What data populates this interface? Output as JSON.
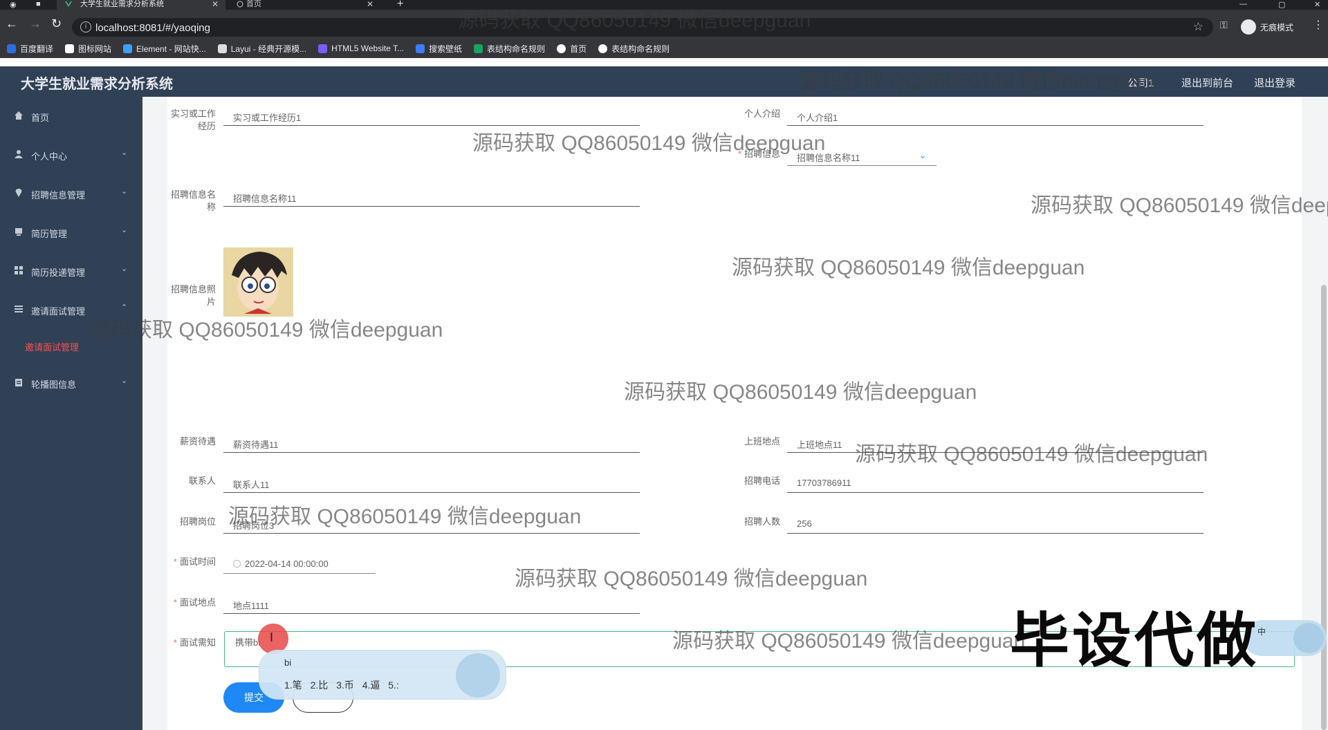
{
  "browser": {
    "tabs": [
      {
        "title": "大学生就业需求分析系统",
        "active": true
      },
      {
        "title": "首页",
        "active": false
      }
    ],
    "url": "localhost:8081/#/yaoqing",
    "incognito_label": "无痕模式",
    "bookmarks": [
      {
        "label": "百度翻译",
        "icon": "baidu-icon",
        "color": "#2b6de4"
      },
      {
        "label": "图标网站",
        "icon": "flag-icon",
        "color": "#ffffff"
      },
      {
        "label": "Element - 网站快...",
        "icon": "element-icon",
        "color": "#409eff"
      },
      {
        "label": "Layui - 经典开源模...",
        "icon": "layui-icon",
        "color": "#dddddd"
      },
      {
        "label": "HTML5 Website T...",
        "icon": "html5-icon",
        "color": "#7a5cff"
      },
      {
        "label": "搜索壁纸",
        "icon": "wallpaper-icon",
        "color": "#3f7df5"
      },
      {
        "label": "表结构命名规则",
        "icon": "sheet-icon",
        "color": "#1aa260"
      },
      {
        "label": "首页",
        "icon": "globe-icon",
        "color": "#ffffff"
      },
      {
        "label": "表结构命名规则",
        "icon": "globe-icon",
        "color": "#ffffff"
      }
    ]
  },
  "header": {
    "title": "大学生就业需求分析系统",
    "user": "公司1",
    "to_front": "退出到前台",
    "logout": "退出登录"
  },
  "sidebar": {
    "items": [
      {
        "label": "首页",
        "icon": "home-icon",
        "expandable": false
      },
      {
        "label": "个人中心",
        "icon": "user-icon",
        "expandable": true
      },
      {
        "label": "招聘信息管理",
        "icon": "pin-icon",
        "expandable": true
      },
      {
        "label": "简历管理",
        "icon": "resume-icon",
        "expandable": true
      },
      {
        "label": "简历投递管理",
        "icon": "grid-icon",
        "expandable": true
      },
      {
        "label": "邀请面试管理",
        "icon": "list-icon",
        "expandable": true,
        "expanded": true
      },
      {
        "label": "轮播图信息",
        "icon": "clipboard-icon",
        "expandable": true
      }
    ],
    "active_subitem": "邀请面试管理"
  },
  "form": {
    "internship_label": "实习或工作经历",
    "internship_value": "实习或工作经历1",
    "intro_label": "个人介绍",
    "intro_value": "个人介绍1",
    "job_info_label": "招聘信息",
    "job_info_value": "招聘信息名称11",
    "job_name_label": "招聘信息名称",
    "job_name_value": "招聘信息名称11",
    "job_photo_label": "招聘信息照片",
    "salary_label": "薪资待遇",
    "salary_value": "薪资待遇11",
    "workplace_label": "上班地点",
    "workplace_value": "上班地点11",
    "contact_label": "联系人",
    "contact_value": "联系人11",
    "phone_label": "招聘电话",
    "phone_value": "17703786911",
    "position_label": "招聘岗位",
    "position_value": "招聘岗位3",
    "headcount_label": "招聘人数",
    "headcount_value": "256",
    "interview_time_label": "面试时间",
    "interview_time_value": "2022-04-14 00:00:00",
    "interview_place_label": "面试地点",
    "interview_place_value": "地点1111",
    "interview_notice_label": "面试需知",
    "interview_notice_value": "携带bi",
    "submit_label": "提交",
    "cancel_label": ""
  },
  "ime": {
    "input": "bi",
    "candidates": "1.笔 2.比 3.币 4.逼 5.:",
    "tray_label": "中"
  },
  "overlays": {
    "watermark": "源码获取 QQ86050149 微信deepguan",
    "stamp": "毕设代做"
  }
}
